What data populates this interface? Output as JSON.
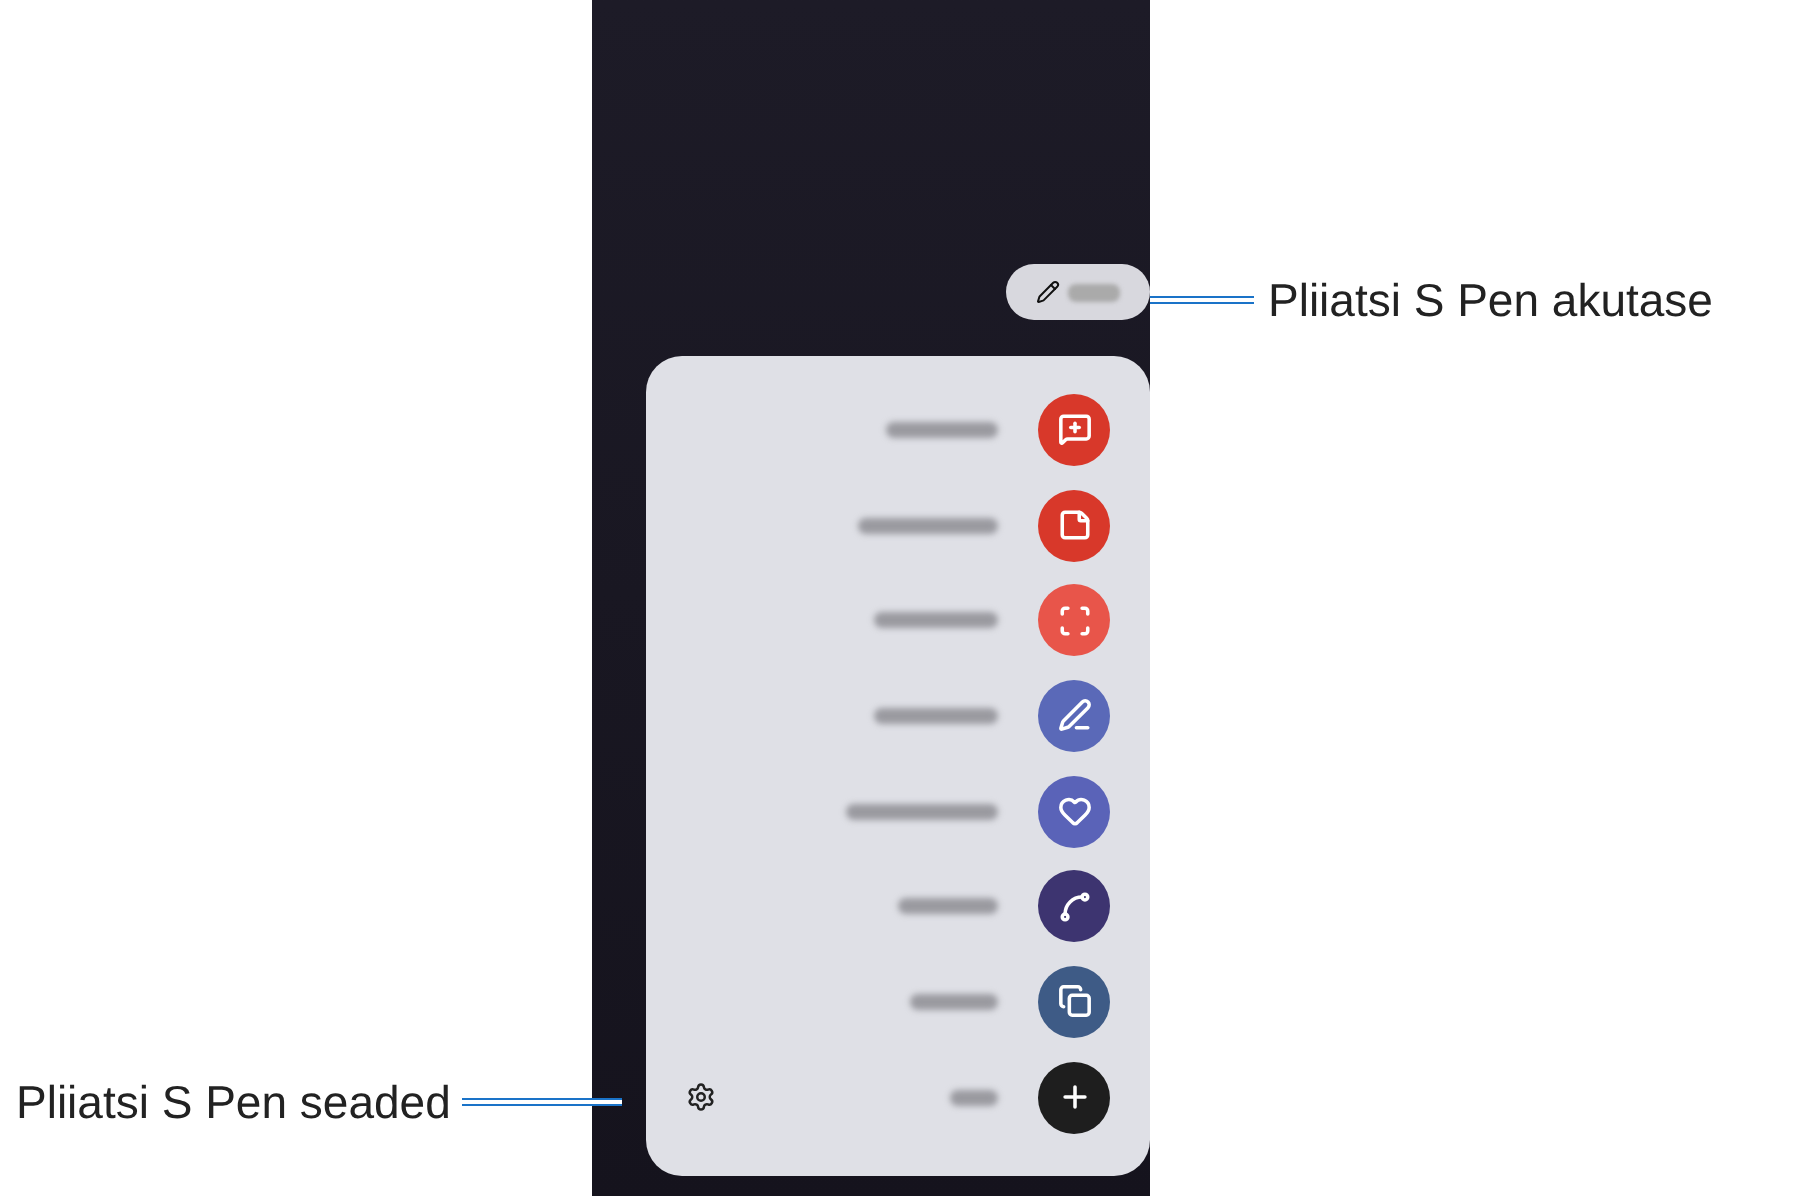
{
  "callouts": [
    {
      "label": "Pliiatsi S Pen akutase"
    },
    {
      "label": "Pliiatsi S Pen seaded"
    }
  ],
  "menu_items": [
    {
      "kind": "note-add",
      "color": "#d8382a"
    },
    {
      "kind": "notes",
      "color": "#d8382a"
    },
    {
      "kind": "select",
      "color": "#e8554a"
    },
    {
      "kind": "write",
      "color": "#5a69b8"
    },
    {
      "kind": "heart",
      "color": "#5a63b8"
    },
    {
      "kind": "doodle",
      "color": "#3d3470"
    },
    {
      "kind": "translate",
      "color": "#3e5b86"
    },
    {
      "kind": "add",
      "color": "#1e1e1e"
    }
  ]
}
